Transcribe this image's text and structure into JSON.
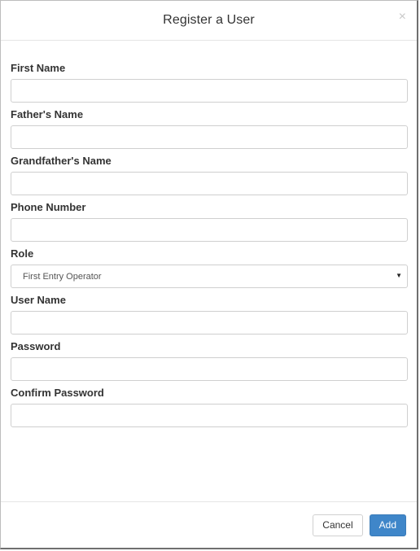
{
  "modal": {
    "title": "Register a User",
    "close_icon": "close-icon",
    "close_glyph": "×"
  },
  "fields": {
    "first_name": {
      "label": "First Name",
      "value": ""
    },
    "fathers_name": {
      "label": "Father's Name",
      "value": ""
    },
    "grandfathers_name": {
      "label": "Grandfather's Name",
      "value": ""
    },
    "phone_number": {
      "label": "Phone Number",
      "value": ""
    },
    "role": {
      "label": "Role",
      "selected": "First Entry Operator",
      "caret_icon": "caret-down-icon",
      "caret_glyph": "▼"
    },
    "user_name": {
      "label": "User Name",
      "value": ""
    },
    "password": {
      "label": "Password",
      "value": ""
    },
    "confirm_password": {
      "label": "Confirm Password",
      "value": ""
    }
  },
  "footer": {
    "cancel_label": "Cancel",
    "add_label": "Add"
  },
  "colors": {
    "primary": "#3f86c9",
    "border": "#cfcfcf"
  }
}
